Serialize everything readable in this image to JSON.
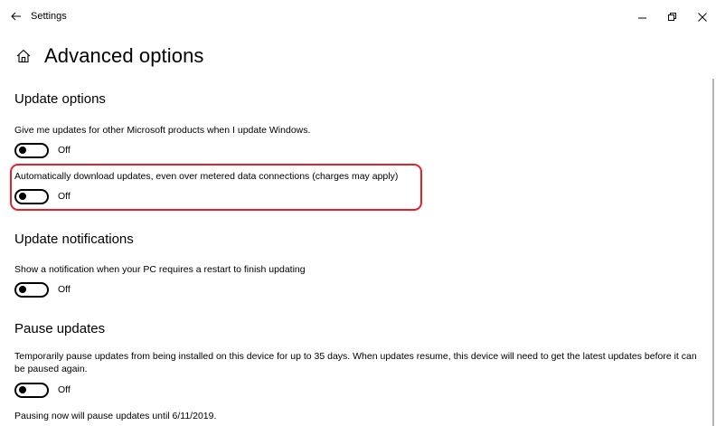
{
  "window": {
    "title": "Settings",
    "controls": [
      "minimize-icon",
      "restore-icon",
      "close-icon"
    ]
  },
  "header": {
    "icon": "home-icon",
    "title": "Advanced options"
  },
  "sections": {
    "update_options": {
      "title": "Update options",
      "other_products": {
        "description": "Give me updates for other Microsoft products when I update Windows.",
        "state": "Off"
      },
      "metered": {
        "description": "Automatically download updates, even over metered data connections (charges may apply)",
        "state": "Off",
        "highlight_color": "#e4212a"
      }
    },
    "update_notifications": {
      "title": "Update notifications",
      "restart_notification": {
        "description": "Show a notification when your PC requires a restart to finish updating",
        "state": "Off"
      }
    },
    "pause_updates": {
      "title": "Pause updates",
      "pause": {
        "description": "Temporarily pause updates from being installed on this device for up to 35 days. When updates resume, this device will need to get the latest updates before it can be paused again.",
        "state": "Off"
      },
      "footer_note": "Pausing now will pause updates until 6/11/2019."
    }
  }
}
